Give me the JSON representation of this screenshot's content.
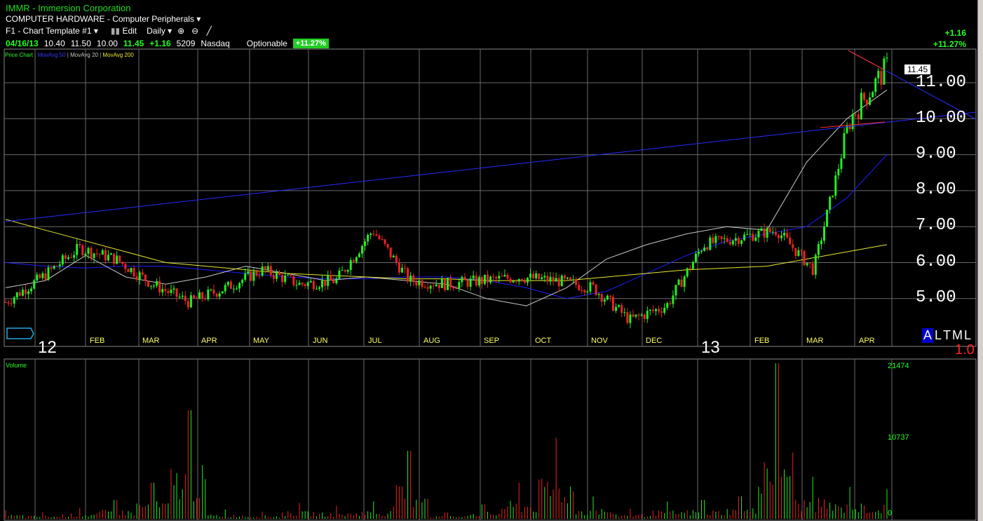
{
  "header": {
    "ticker_line": "IMMR - Immersion Corporation",
    "industry_line": "COMPUTER HARDWARE - Computer Peripherals",
    "template_label": "F1 - Chart Template #1",
    "edit_label": "Edit",
    "period_label": "Daily"
  },
  "quote": {
    "date": "04/16/13",
    "open": "10.40",
    "high": "11.50",
    "low": "10.00",
    "close": "11.45",
    "change": "+1.16",
    "volume": "5209",
    "exchange": "Nasdaq",
    "optionable": "Optionable",
    "pct_badge": "+11.27%"
  },
  "change_panel": {
    "abs": "+1.16",
    "pct": "+11.27%"
  },
  "legend": {
    "price_chart": "Price Chart",
    "ma50": "MovAvg 50",
    "ma20": "MovAvg 20",
    "ma200": "MovAvg 200"
  },
  "price_tag": "11.45",
  "axis": {
    "y_labels": [
      "11.00",
      "10.00",
      "9.00",
      "8.00",
      "7.00",
      "6.00",
      "5.00"
    ],
    "months": [
      "FEB",
      "MAR",
      "APR",
      "MAY",
      "JUN",
      "JUL",
      "AUG",
      "SEP",
      "OCT",
      "NOV",
      "DEC",
      "FEB",
      "MAR",
      "APR"
    ],
    "years": [
      "12",
      "13"
    ]
  },
  "scale_buttons": [
    "A",
    "L",
    "T",
    "M",
    "L"
  ],
  "version": "1.0",
  "volume_panel": {
    "label": "Volume",
    "max": "21474",
    "mid": "10737",
    "min": "0"
  },
  "colors": {
    "up": "#22ee22",
    "down": "#ee2222",
    "ma50": "#1e1eff",
    "ma20": "#c8c8c8",
    "ma200": "#e8e832",
    "grid": "#6a6a6a"
  },
  "chart_data": {
    "type": "candlestick",
    "title": "IMMR - Immersion Corporation",
    "ylim": [
      4.2,
      12.0
    ],
    "y_ticks": [
      11,
      10,
      9,
      8,
      7,
      6,
      5
    ],
    "x_ticks": [
      "12",
      "FEB",
      "MAR",
      "APR",
      "MAY",
      "JUN",
      "JUL",
      "AUG",
      "SEP",
      "OCT",
      "NOV",
      "DEC",
      "13",
      "FEB",
      "MAR",
      "APR"
    ],
    "series": [
      {
        "name": "MovAvg 50",
        "values": [
          6.0,
          5.9,
          5.85,
          5.9,
          5.9,
          5.8,
          5.7,
          5.6,
          5.55,
          5.55,
          5.6,
          5.6,
          5.5,
          5.3,
          5.0,
          5.2,
          5.7,
          6.2,
          6.6,
          6.8,
          7.0,
          7.8,
          9.0
        ]
      },
      {
        "name": "MovAvg 20",
        "values": [
          5.3,
          5.5,
          6.2,
          5.6,
          5.4,
          5.6,
          5.9,
          5.7,
          5.5,
          5.6,
          5.5,
          5.4,
          5.0,
          4.8,
          5.3,
          6.1,
          6.5,
          6.8,
          7.0,
          6.9,
          8.8,
          10.0,
          10.8
        ]
      },
      {
        "name": "MovAvg 200",
        "values": [
          7.2,
          6.9,
          6.6,
          6.3,
          6.0,
          5.9,
          5.8,
          5.7,
          5.65,
          5.6,
          5.55,
          5.55,
          5.5,
          5.5,
          5.5,
          5.6,
          5.7,
          5.8,
          5.85,
          5.9,
          6.1,
          6.3,
          6.5
        ]
      }
    ],
    "closes": [
      4.9,
      5.6,
      6.4,
      6.1,
      5.4,
      4.9,
      5.3,
      5.8,
      5.4,
      5.5,
      6.9,
      5.5,
      5.4,
      5.5,
      5.6,
      5.5,
      5.3,
      4.4,
      4.8,
      6.5,
      6.7,
      6.9,
      5.8,
      10.0,
      11.45
    ],
    "volume": [
      1200,
      900,
      1500,
      2600,
      5000,
      15000,
      1300,
      1000,
      2200,
      1800,
      2400,
      9400,
      900,
      2000,
      5000,
      11200,
      3100,
      1400,
      2400,
      2600,
      3100,
      21474,
      5800,
      4400,
      4100
    ]
  }
}
